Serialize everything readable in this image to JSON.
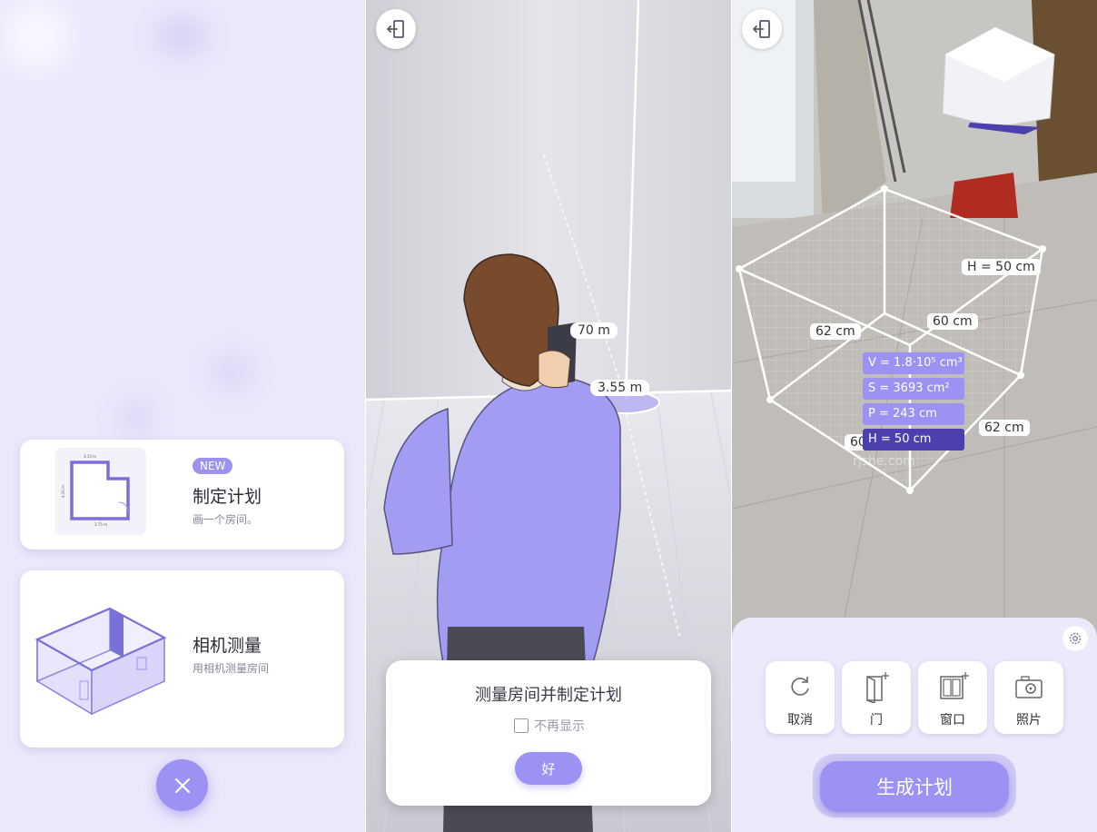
{
  "panel1": {
    "plan_card": {
      "badge": "NEW",
      "title": "制定计划",
      "subtitle": "画一个房间。",
      "plan_dims": {
        "top": "3.15 m",
        "side": "4.10 m",
        "bottom": "3.75 m"
      }
    },
    "camera_card": {
      "title": "相机测量",
      "subtitle": "用相机测量房间"
    }
  },
  "panel2": {
    "measure_top": "70 m",
    "measure_bottom": "3.55 m",
    "dialog": {
      "title": "测量房间并制定计划",
      "checkbox_label": "不再显示",
      "ok_label": "好"
    }
  },
  "panel3": {
    "labels": {
      "height_top": "H = 50 cm",
      "left_62": "62 cm",
      "back_60": "60 cm",
      "right_62": "62 cm",
      "front_60": "60"
    },
    "info": {
      "volume": "V = 1.8·10⁵ cm³",
      "surface": "S = 3693 cm²",
      "perimeter": "P = 243 cm",
      "height": "H = 50 cm"
    },
    "watermark": "rjshe.com",
    "tools": [
      {
        "label": "取消",
        "icon": "undo-icon"
      },
      {
        "label": "门",
        "icon": "add-door-icon"
      },
      {
        "label": "窗口",
        "icon": "add-window-icon"
      },
      {
        "label": "照片",
        "icon": "camera-icon"
      }
    ],
    "generate_label": "生成计划"
  },
  "colors": {
    "accent": "#9b92f4",
    "accent_dark": "#4b40ad",
    "panel_bg": "#ece9fb"
  }
}
